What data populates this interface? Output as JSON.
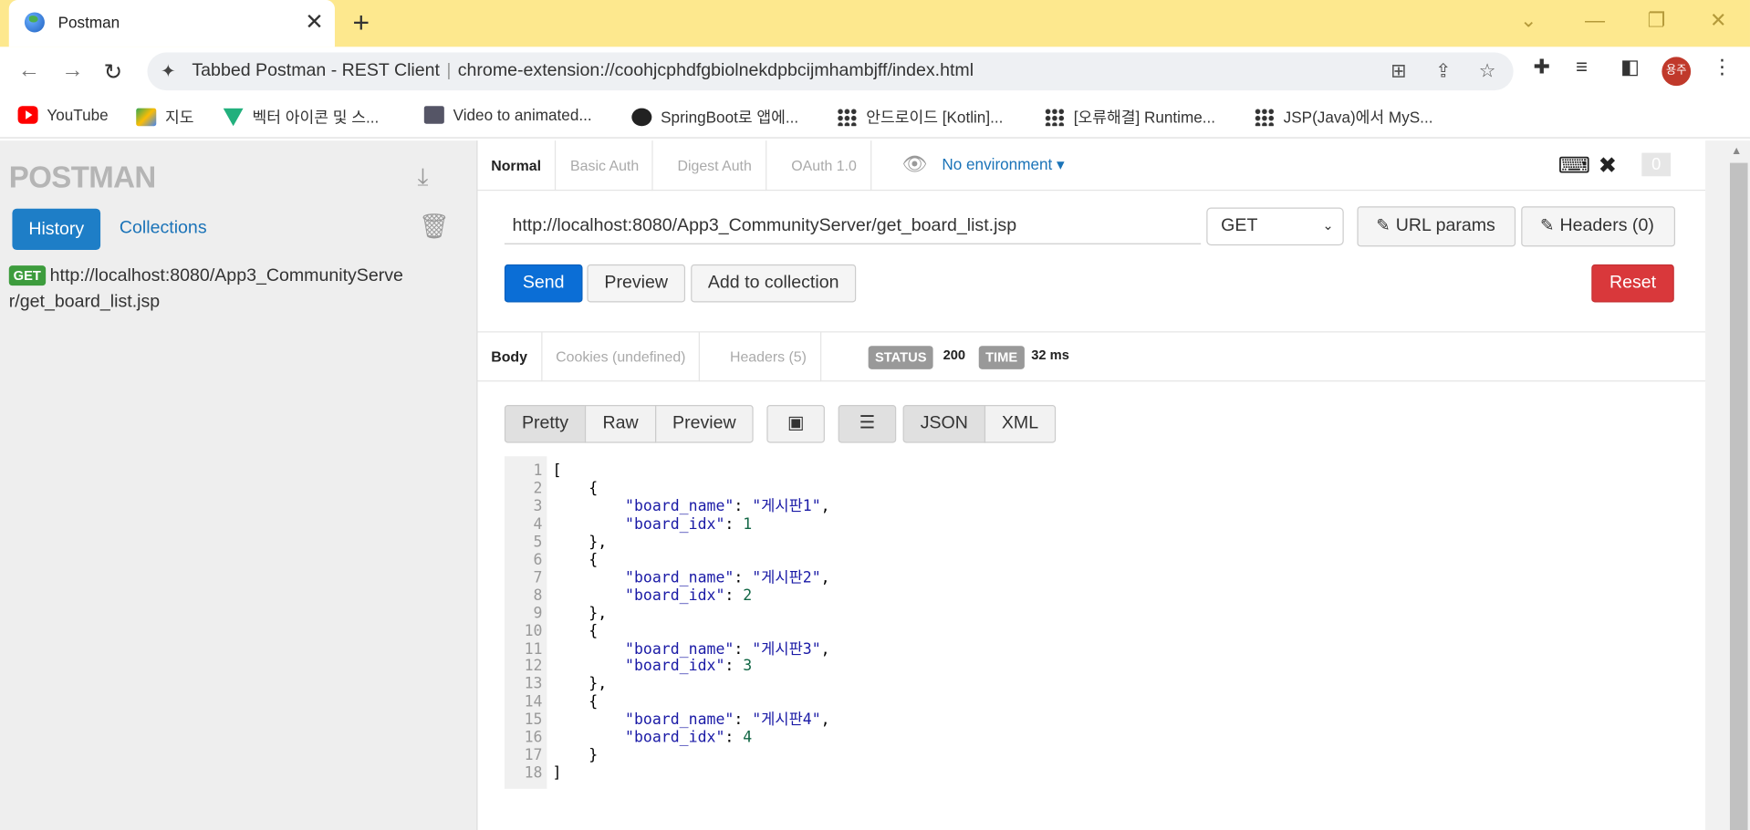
{
  "browser": {
    "tab_title": "Postman",
    "tab_close": "✕",
    "new_tab": "+",
    "omnibox_site": "Tabbed Postman - REST Client",
    "omnibox_url": "chrome-extension://coohjcphdfgbiolnekdpbcijmhambjff/index.html",
    "avatar_text": "용주",
    "bookmarks": [
      {
        "label": "YouTube",
        "icon": "youtube-icon"
      },
      {
        "label": "지도",
        "icon": "maps-icon"
      },
      {
        "label": "벡터 아이콘 및 스...",
        "icon": "vector-icon"
      },
      {
        "label": "Video to animated...",
        "icon": "video-icon"
      },
      {
        "label": "SpringBoot로 앱에...",
        "icon": "globe-icon"
      },
      {
        "label": "안드로이드 [Kotlin]...",
        "icon": "dots-icon"
      },
      {
        "label": "[오류해결] Runtime...",
        "icon": "dots-icon"
      },
      {
        "label": "JSP(Java)에서 MyS...",
        "icon": "dots-icon"
      }
    ]
  },
  "sidebar": {
    "logo": "POSTMAN",
    "history_label": "History",
    "collections_label": "Collections",
    "history_item": {
      "method": "GET",
      "url": "http://localhost:8080/App3_CommunityServer/get_board_list.jsp"
    }
  },
  "auth_tabs": [
    "Normal",
    "Basic Auth",
    "Digest Auth",
    "OAuth 1.0"
  ],
  "environment": "No environment",
  "notification_count": "0",
  "request": {
    "url": "http://localhost:8080/App3_CommunityServer/get_board_list.jsp",
    "method": "GET",
    "url_params_label": "URL params",
    "headers_label": "Headers (0)",
    "send_label": "Send",
    "preview_label": "Preview",
    "add_collection_label": "Add to collection",
    "reset_label": "Reset"
  },
  "response": {
    "tabs": [
      "Body",
      "Cookies (undefined)",
      "Headers (5)"
    ],
    "status_label": "STATUS",
    "status_value": "200",
    "time_label": "TIME",
    "time_value": "32 ms",
    "view_modes": [
      "Pretty",
      "Raw",
      "Preview"
    ],
    "formats": [
      "JSON",
      "XML"
    ],
    "body_lines": [
      "[",
      "    {",
      "        \"board_name\": \"게시판1\",",
      "        \"board_idx\": 1",
      "    },",
      "    {",
      "        \"board_name\": \"게시판2\",",
      "        \"board_idx\": 2",
      "    },",
      "    {",
      "        \"board_name\": \"게시판3\",",
      "        \"board_idx\": 3",
      "    },",
      "    {",
      "        \"board_name\": \"게시판4\",",
      "        \"board_idx\": 4",
      "    }",
      "]"
    ]
  },
  "colors": {
    "tabstrip": "#fde88e",
    "send": "#0b6ed6",
    "reset": "#d9383b",
    "history": "#1e7ec7",
    "get_badge": "#3d9c3d"
  }
}
